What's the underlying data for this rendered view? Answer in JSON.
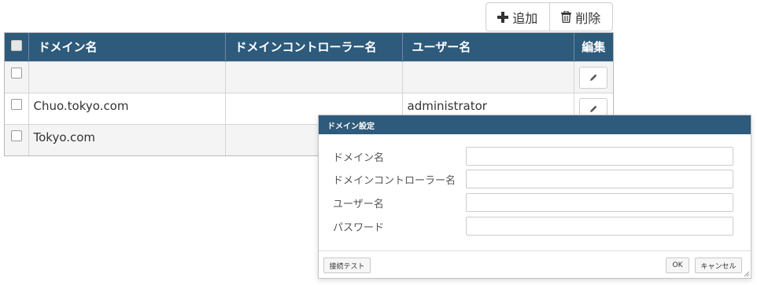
{
  "toolbar": {
    "add_label": "追加",
    "delete_label": "削除"
  },
  "table": {
    "columns": [
      "ドメイン名",
      "ドメインコントローラー名",
      "ユーザー名",
      "編集"
    ],
    "rows": [
      {
        "domain": "",
        "controller": "",
        "user": ""
      },
      {
        "domain": "Chuo.tokyo.com",
        "controller": "",
        "user": "administrator"
      },
      {
        "domain": "Tokyo.com",
        "controller": "",
        "user": ""
      }
    ]
  },
  "dialog": {
    "title": "ドメイン設定",
    "fields": [
      {
        "label": "ドメイン名",
        "value": ""
      },
      {
        "label": "ドメインコントローラー名",
        "value": ""
      },
      {
        "label": "ユーザー名",
        "value": ""
      },
      {
        "label": "パスワード",
        "value": ""
      }
    ],
    "test_button": "接続テスト",
    "ok_button": "OK",
    "cancel_button": "キャンセル"
  },
  "colors": {
    "header_bg": "#2e5a7b",
    "row_alt_bg": "#f4f4f4"
  },
  "icons": [
    "plus-icon",
    "trash-icon",
    "pencil-icon",
    "resize-grip-icon"
  ]
}
